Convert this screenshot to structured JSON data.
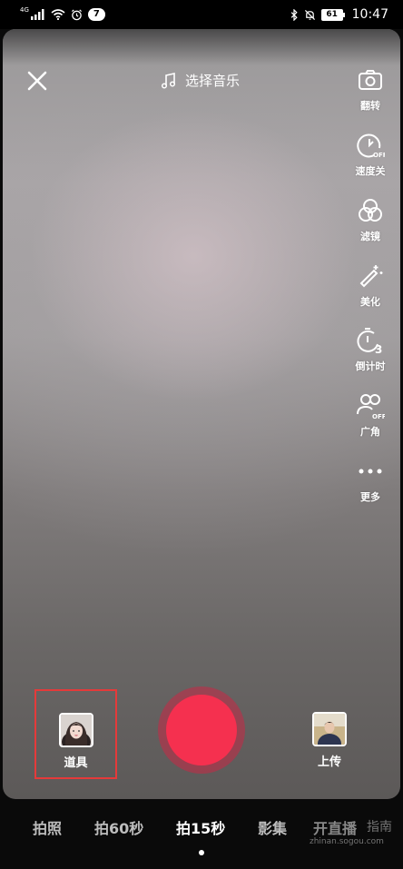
{
  "status_bar": {
    "network": "4G",
    "notification_count": "7",
    "battery": "61",
    "time": "10:47"
  },
  "top": {
    "music_label": "选择音乐"
  },
  "toolbar": {
    "flip": "翻转",
    "speed": "速度关",
    "filter": "滤镜",
    "beautify": "美化",
    "timer": "倒计时",
    "wide": "广角",
    "more": "更多"
  },
  "bottom": {
    "props_label": "道具",
    "upload_label": "上传"
  },
  "modes": [
    "拍照",
    "拍60秒",
    "拍15秒",
    "影集",
    "开直播"
  ],
  "active_mode_index": 2,
  "watermark": {
    "text": "指南",
    "url": "zhinan.sogou.com"
  },
  "colors": {
    "record": "#f5304f",
    "highlight_box": "#e53a3a"
  }
}
